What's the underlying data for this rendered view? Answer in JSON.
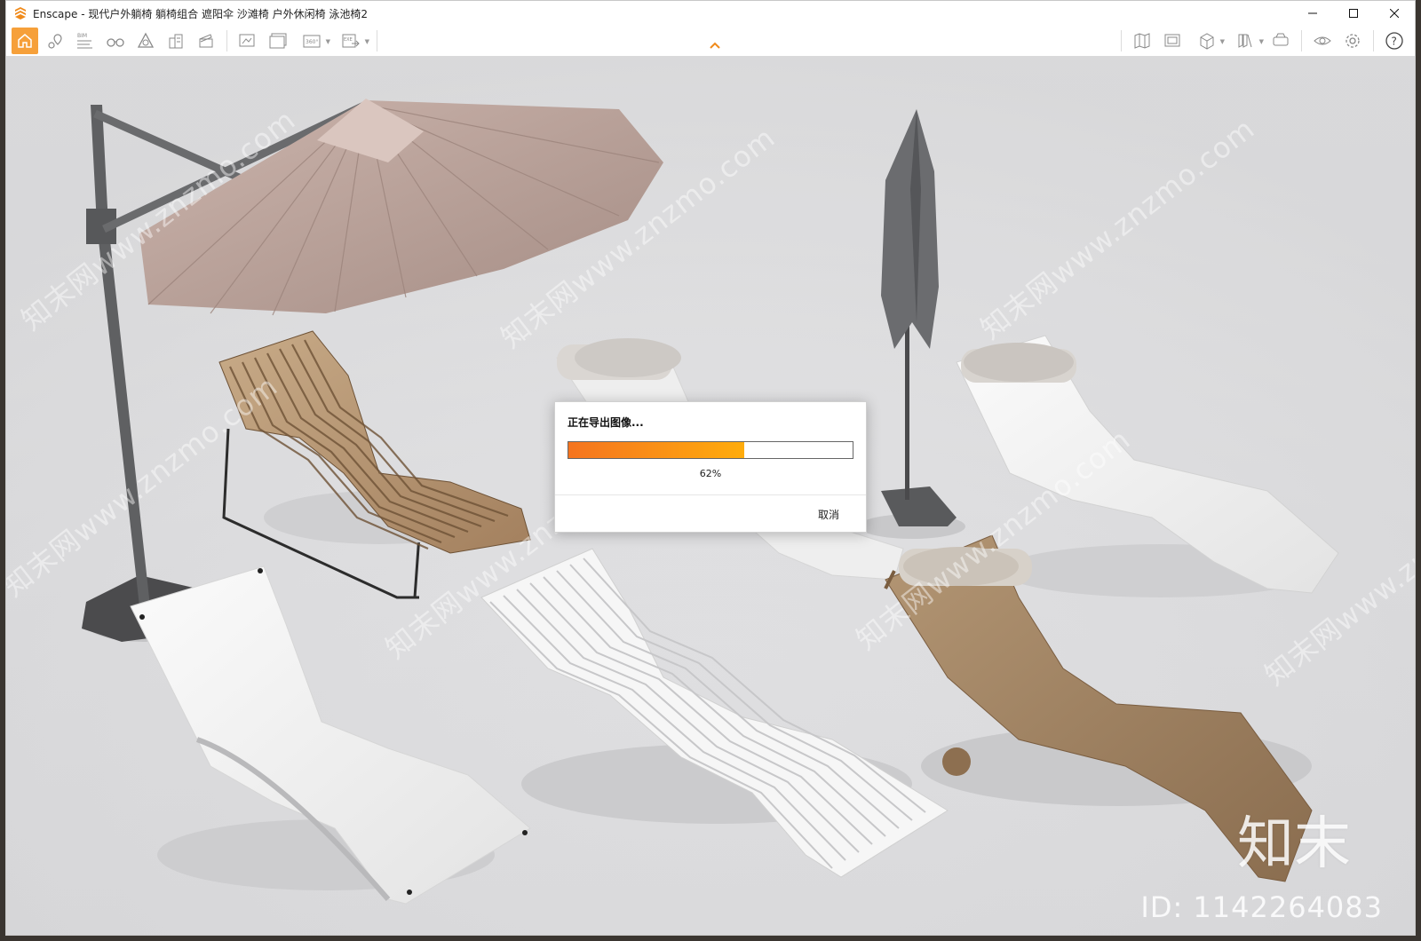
{
  "window": {
    "title": "Enscape - 现代户外躺椅 躺椅组合 遮阳伞 沙滩椅 户外休闲椅 泳池椅2",
    "accent_color": "#f6a03a",
    "controls": [
      "minimize-icon",
      "maximize-icon",
      "close-icon"
    ]
  },
  "toolbar": {
    "left_icons": [
      "home-icon",
      "location-pin-icon",
      "bim-icon",
      "binoculars-icon",
      "asset-library-icon",
      "buildings-icon",
      "clapperboard-icon",
      "screenshot-icon",
      "batch-render-icon",
      "panorama-360-icon",
      "export-exe-icon"
    ],
    "bim_label": "BIM",
    "pano_label": "360°",
    "exe_label": "EXE",
    "right_icons": [
      "map-icon",
      "image-view-icon",
      "cube-view-icon",
      "books-icon",
      "vr-headset-icon",
      "eye-icon",
      "gear-icon",
      "help-icon"
    ]
  },
  "dialog": {
    "title": "正在导出图像...",
    "progress_percent": 62,
    "progress_text": "62%",
    "cancel_label": "取消"
  },
  "overlay": {
    "watermark_text": "知末网www.znzmo.com",
    "brand": "知末",
    "id_text": "ID: 1142264083"
  }
}
